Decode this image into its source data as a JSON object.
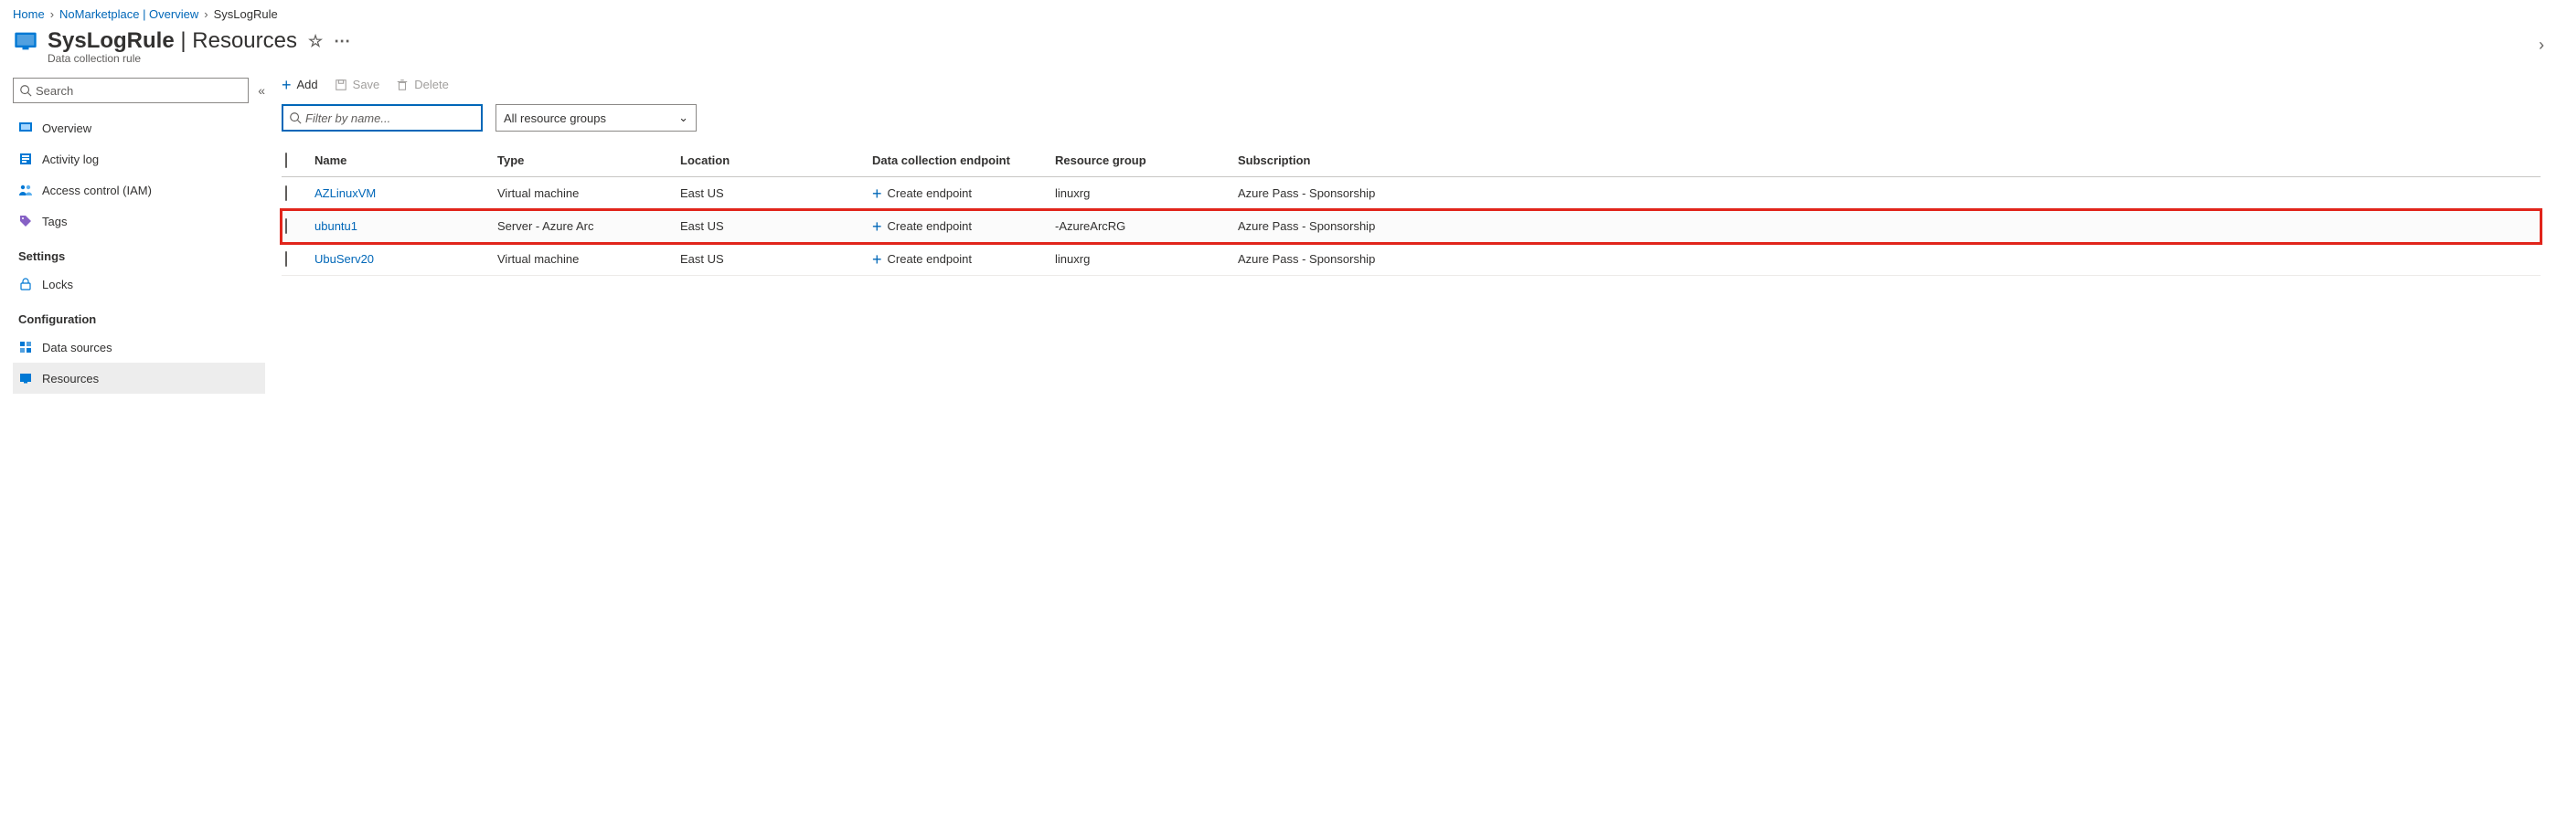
{
  "breadcrumbs": [
    {
      "label": "Home"
    },
    {
      "label": "NoMarketplace | Overview"
    },
    {
      "label": "SysLogRule"
    }
  ],
  "header": {
    "title_main": "SysLogRule",
    "title_sep": "|",
    "title_sub": "Resources",
    "subtitle": "Data collection rule"
  },
  "sidebar": {
    "search_placeholder": "Search",
    "items": [
      {
        "label": "Overview"
      },
      {
        "label": "Activity log"
      },
      {
        "label": "Access control (IAM)"
      },
      {
        "label": "Tags"
      }
    ],
    "group_settings": "Settings",
    "settings_item": {
      "label": "Locks"
    },
    "group_configuration": "Configuration",
    "config_items": [
      {
        "label": "Data sources"
      },
      {
        "label": "Resources"
      }
    ]
  },
  "toolbar": {
    "add": "Add",
    "save": "Save",
    "delete": "Delete"
  },
  "filters": {
    "name_placeholder": "Filter by name...",
    "rg_selected": "All resource groups"
  },
  "table": {
    "headers": {
      "name": "Name",
      "type": "Type",
      "location": "Location",
      "dce": "Data collection endpoint",
      "rg": "Resource group",
      "sub": "Subscription"
    },
    "create_ep_label": "Create endpoint",
    "rows": [
      {
        "name": "AZLinuxVM",
        "type": "Virtual machine",
        "location": "East US",
        "rg": "linuxrg",
        "sub": "Azure Pass - Sponsorship",
        "highlight": false
      },
      {
        "name": "ubuntu1",
        "type": "Server - Azure Arc",
        "location": "East US",
        "rg": "-AzureArcRG",
        "sub": "Azure Pass - Sponsorship",
        "highlight": true
      },
      {
        "name": "UbuServ20",
        "type": "Virtual machine",
        "location": "East US",
        "rg": "linuxrg",
        "sub": "Azure Pass - Sponsorship",
        "highlight": false
      }
    ]
  }
}
